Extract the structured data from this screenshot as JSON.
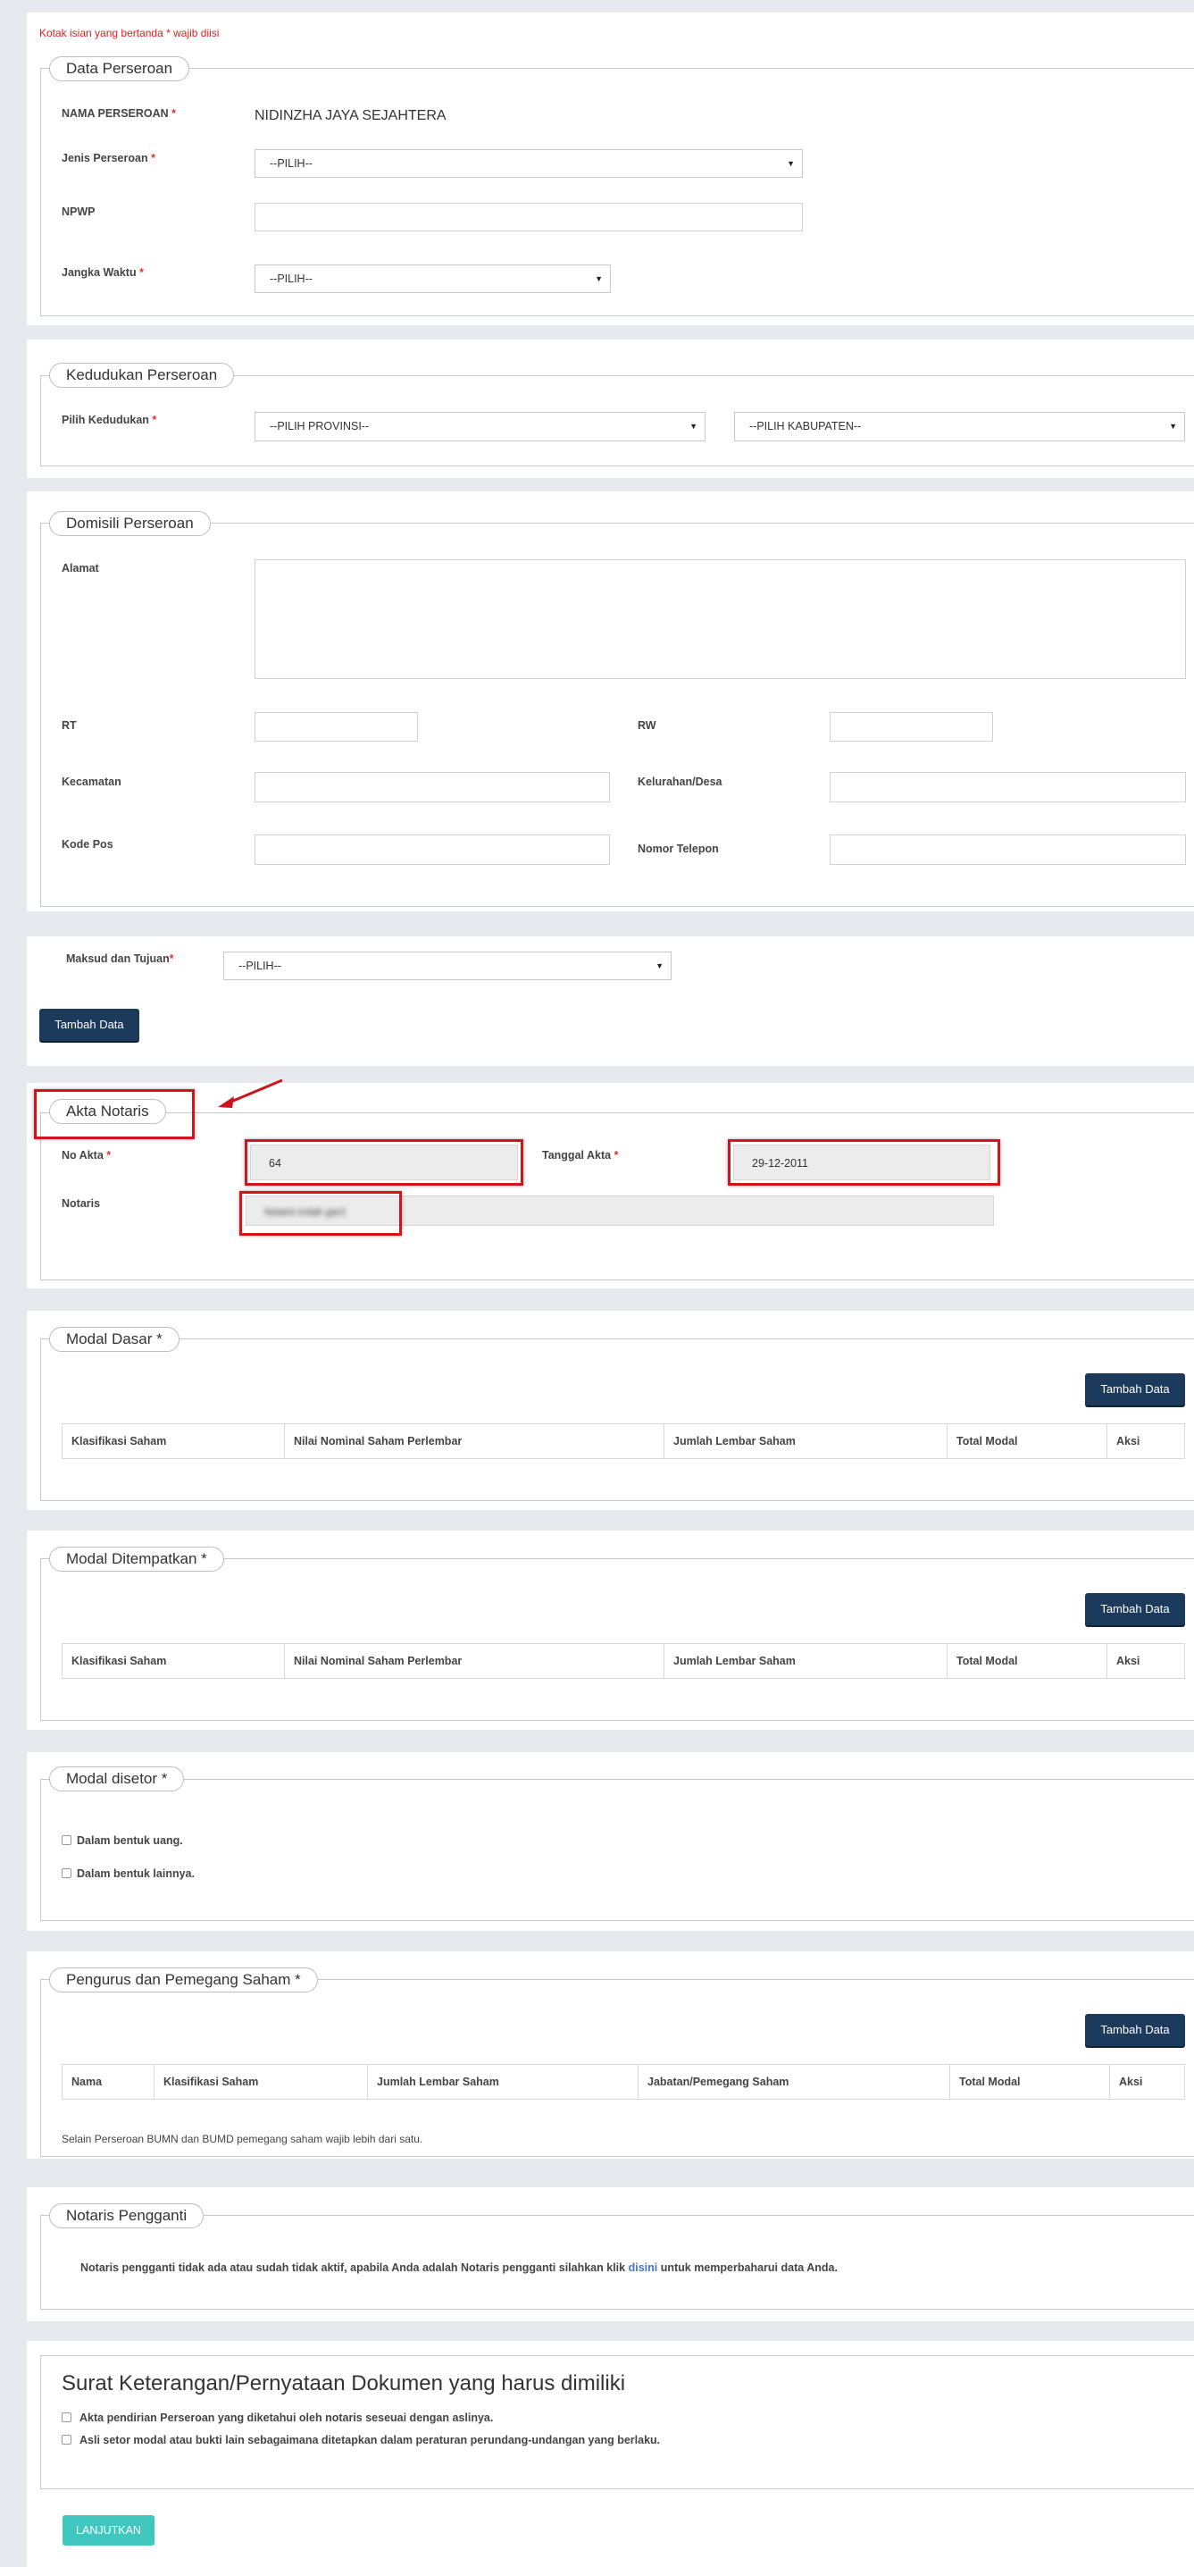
{
  "required_note": "Kotak isian yang bertanda * wajib diisi",
  "data_perseroan": {
    "legend": "Data Perseroan",
    "nama_label": "NAMA PERSEROAN",
    "nama_value": "NIDINZHA JAYA SEJAHTERA",
    "jenis_label": "Jenis Perseroan",
    "jenis_value": "--PILIH--",
    "npwp_label": "NPWP",
    "npwp_value": "",
    "jangka_label": "Jangka Waktu",
    "jangka_value": "--PILIH--"
  },
  "kedudukan": {
    "legend": "Kedudukan Perseroan",
    "label": "Pilih Kedudukan",
    "provinsi": "--PILIH PROVINSI--",
    "kabupaten": "--PILIH KABUPATEN--"
  },
  "domisili": {
    "legend": "Domisili Perseroan",
    "alamat": "Alamat",
    "rt": "RT",
    "rw": "RW",
    "kecamatan": "Kecamatan",
    "kelurahan": "Kelurahan/Desa",
    "kode_pos": "Kode Pos",
    "telepon": "Nomor Telepon"
  },
  "maksud": {
    "label": "Maksud dan Tujuan",
    "value": "--PILIH--",
    "button": "Tambah Data"
  },
  "akta": {
    "legend": "Akta Notaris",
    "no_label": "No Akta",
    "no_value": "64",
    "tanggal_label": "Tanggal Akta",
    "tanggal_value": "29-12-2011",
    "notaris_label": "Notaris",
    "notaris_value": "Notaris Indah gar3"
  },
  "modal_dasar": {
    "legend": "Modal Dasar *",
    "button": "Tambah Data",
    "columns": [
      "Klasifikasi Saham",
      "Nilai Nominal Saham Perlembar",
      "Jumlah Lembar Saham",
      "Total Modal",
      "Aksi"
    ]
  },
  "modal_ditempatkan": {
    "legend": "Modal Ditempatkan *",
    "button": "Tambah Data",
    "columns": [
      "Klasifikasi Saham",
      "Nilai Nominal Saham Perlembar",
      "Jumlah Lembar Saham",
      "Total Modal",
      "Aksi"
    ]
  },
  "modal_disetor": {
    "legend": "Modal disetor *",
    "opt1": "Dalam bentuk uang.",
    "opt2": "Dalam bentuk lainnya."
  },
  "pengurus": {
    "legend": "Pengurus dan Pemegang Saham *",
    "button": "Tambah Data",
    "columns": [
      "Nama",
      "Klasifikasi Saham",
      "Jumlah Lembar Saham",
      "Jabatan/Pemegang Saham",
      "Total Modal",
      "Aksi"
    ],
    "note": "Selain Perseroan BUMN dan BUMD pemegang saham wajib lebih dari satu."
  },
  "notaris_pengganti": {
    "legend": "Notaris Pengganti",
    "text_before": "Notaris pengganti tidak ada atau sudah tidak aktif, apabila Anda adalah Notaris pengganti silahkan klik",
    "link": "disini",
    "text_after": "untuk memperbaharui data Anda."
  },
  "surat": {
    "title": "Surat Keterangan/Pernyataan Dokumen yang harus dimiliki",
    "item1": "Akta pendirian Perseroan yang diketahui oleh notaris seseuai dengan aslinya.",
    "item2": "Asli setor modal atau bukti lain sebagaimana ditetapkan dalam peraturan perundang-undangan yang berlaku.",
    "button": "LANJUTKAN"
  },
  "colors": {
    "primary_button": "#1c3a5c",
    "submit_button": "#3fc7c0",
    "highlight": "#d0151b",
    "required": "#d33"
  }
}
